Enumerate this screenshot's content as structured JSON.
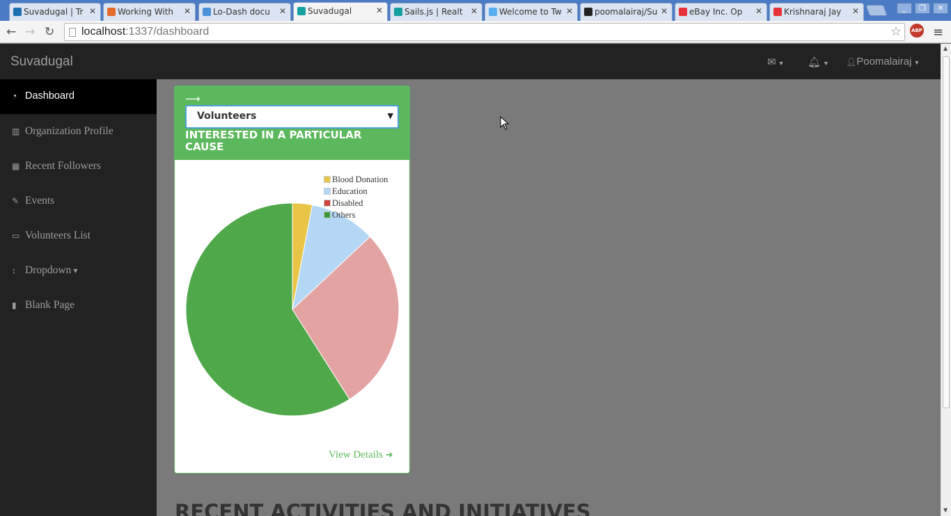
{
  "browser": {
    "tabs": [
      {
        "label": "Suvadugal | Tr",
        "favicon_color": "#1e6fb0"
      },
      {
        "label": "Working With",
        "favicon_color": "#e56b2c"
      },
      {
        "label": "Lo-Dash docu",
        "favicon_color": "#4a90d9"
      },
      {
        "label": "Suvadugal",
        "favicon_color": "#14a0a0",
        "active": true
      },
      {
        "label": "Sails.js | Realt",
        "favicon_color": "#14a0a0"
      },
      {
        "label": "Welcome to Tw",
        "favicon_color": "#55acee"
      },
      {
        "label": "poomalairaj/Su",
        "favicon_color": "#222222"
      },
      {
        "label": "eBay Inc. Op",
        "favicon_color": "#e53238"
      },
      {
        "label": "Krishnaraj Jay",
        "favicon_color": "#e53238"
      }
    ],
    "url_host": "localhost",
    "url_path": ":1337/dashboard",
    "abp_label": "ABP"
  },
  "app": {
    "brand": "Suvadugal",
    "user_name": "Poomalairaj"
  },
  "sidebar": {
    "items": [
      {
        "label": "Dashboard",
        "icon": "dashboard-icon",
        "active": true
      },
      {
        "label": "Organization Profile",
        "icon": "bar-chart-icon"
      },
      {
        "label": "Recent Followers",
        "icon": "table-icon"
      },
      {
        "label": "Events",
        "icon": "edit-icon"
      },
      {
        "label": "Volunteers List",
        "icon": "desktop-icon"
      },
      {
        "label": "Dropdown",
        "icon": "arrows-v-icon"
      },
      {
        "label": "Blank Page",
        "icon": "file-icon"
      }
    ]
  },
  "panel": {
    "select_value": "Volunteers",
    "title": "INTERESTED IN A PARTICULAR CAUSE",
    "view_details": "View Details"
  },
  "chart_data": {
    "type": "pie",
    "categories": [
      "Blood Donation",
      "Education",
      "Disabled",
      "Others"
    ],
    "values": [
      3,
      10,
      28,
      59
    ],
    "colors": [
      "#e8c547",
      "#b3d7f5",
      "#e4a3a3",
      "#4fa84a"
    ],
    "legend_colors": [
      "#e8c547",
      "#b3d7f5",
      "#d0413c",
      "#3a9a3a"
    ],
    "legend_position": "top-right"
  },
  "section": {
    "title": "RECENT ACTIVITIES AND INITIATIVES"
  }
}
